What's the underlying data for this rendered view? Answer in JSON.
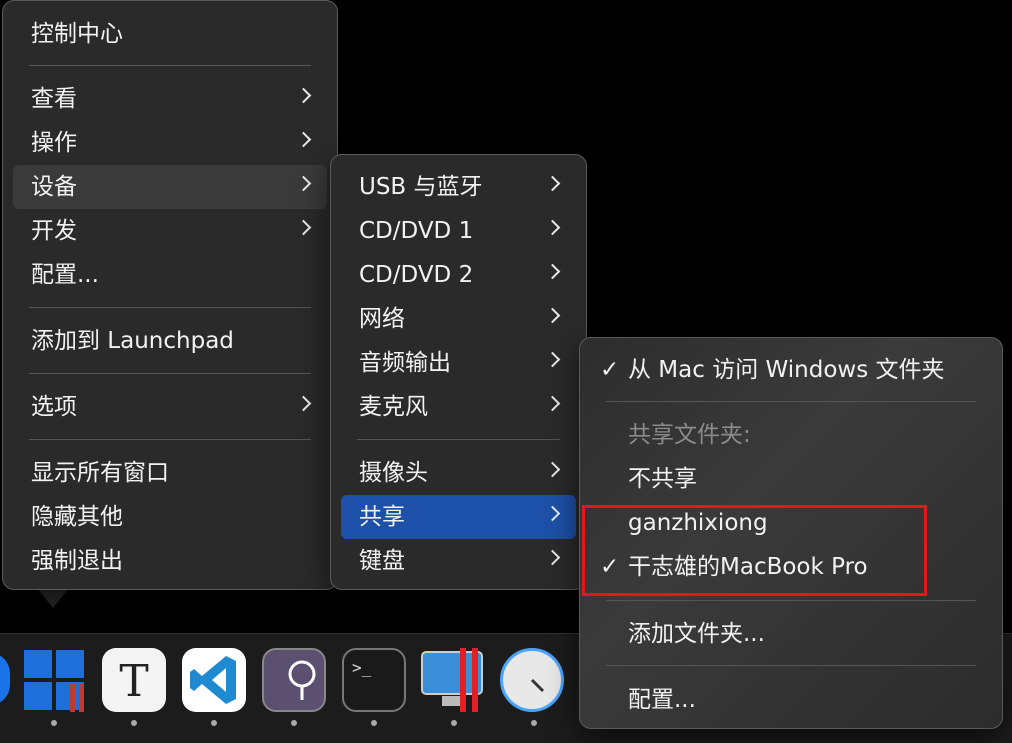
{
  "menu_main": {
    "title": "控制中心",
    "items": [
      {
        "label": "查看"
      },
      {
        "label": "操作"
      },
      {
        "label": "设备"
      },
      {
        "label": "开发"
      },
      {
        "label": "配置..."
      },
      {
        "label": "添加到 Launchpad"
      },
      {
        "label": "选项"
      },
      {
        "label": "显示所有窗口"
      },
      {
        "label": "隐藏其他"
      },
      {
        "label": "强制退出"
      }
    ]
  },
  "menu_devices": {
    "items": [
      {
        "label": "USB 与蓝牙"
      },
      {
        "label": "CD/DVD 1"
      },
      {
        "label": "CD/DVD 2"
      },
      {
        "label": "网络"
      },
      {
        "label": "音频输出"
      },
      {
        "label": "麦克风"
      },
      {
        "label": "摄像头"
      },
      {
        "label": "共享"
      },
      {
        "label": "键盘"
      }
    ]
  },
  "menu_sharing": {
    "access_windows": "从 Mac 访问 Windows 文件夹",
    "shared_header": "共享文件夹:",
    "no_share": "不共享",
    "user_home": "ganzhixiong",
    "macbook": "干志雄的MacBook Pro",
    "add_folder": "添加文件夹...",
    "configure": "配置...",
    "checkmark": "✓"
  },
  "dock": {
    "textedit_glyph": "T",
    "terminal_glyph": ">_"
  },
  "colors": {
    "selection": "#1d50a8",
    "highlight_box": "#e8151b"
  }
}
